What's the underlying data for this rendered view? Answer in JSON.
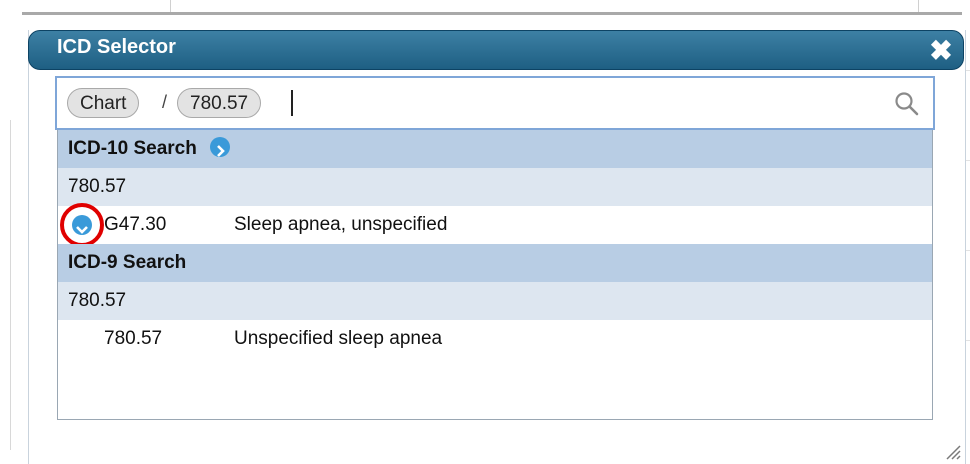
{
  "dialog": {
    "title": "ICD Selector",
    "close_symbol": "✖"
  },
  "search": {
    "crumbs": [
      "Chart",
      "780.57"
    ],
    "separator": "/",
    "input_value": "",
    "icon": "search-icon"
  },
  "icd10": {
    "header": "ICD-10 Search",
    "header_icon": "arrow-right-circle-icon",
    "query": "780.57",
    "results": [
      {
        "code": "G47.30",
        "description": "Sleep apnea, unspecified",
        "icon": "chevron-down-circle-icon"
      }
    ]
  },
  "icd9": {
    "header": "ICD-9 Search",
    "query": "780.57",
    "results": [
      {
        "code": "780.57",
        "description": "Unspecified sleep apnea"
      }
    ]
  },
  "colors": {
    "titlebar": "#1e5f83",
    "section_header": "#b8cde4",
    "group_row": "#dde6f0",
    "icon_blue": "#3a9ad9",
    "highlight_ring": "#e00000"
  }
}
